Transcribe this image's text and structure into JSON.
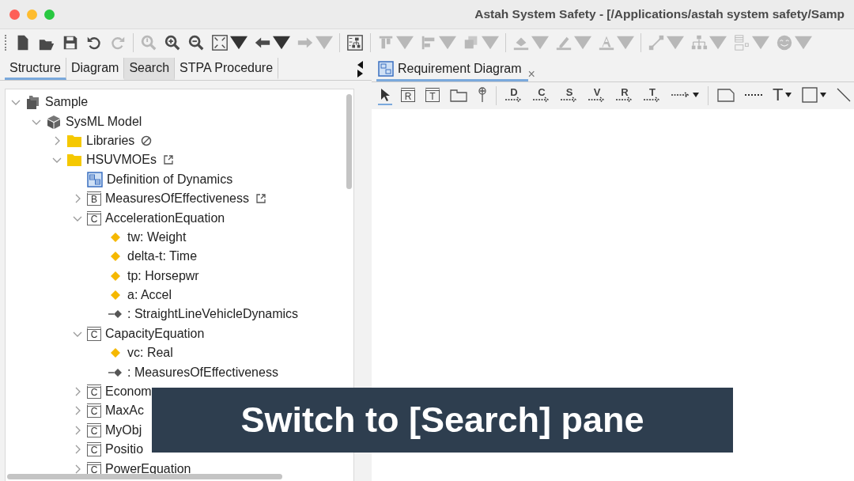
{
  "window": {
    "title": "Astah System Safety - [/Applications/astah system safety/Samp"
  },
  "main_toolbar": [
    {
      "kind": "new",
      "disabled": false,
      "dropdown": false
    },
    {
      "kind": "open",
      "disabled": false,
      "dropdown": false
    },
    {
      "kind": "save",
      "disabled": false,
      "dropdown": false
    },
    {
      "kind": "undo",
      "disabled": false,
      "dropdown": false
    },
    {
      "kind": "redo",
      "disabled": true,
      "dropdown": false
    },
    {
      "kind": "separator"
    },
    {
      "kind": "find",
      "disabled": true,
      "dropdown": false
    },
    {
      "kind": "zoom-in",
      "disabled": false,
      "dropdown": false
    },
    {
      "kind": "zoom-out",
      "disabled": false,
      "dropdown": false
    },
    {
      "kind": "fit",
      "disabled": false,
      "dropdown": true
    },
    {
      "kind": "back",
      "disabled": false,
      "dropdown": true
    },
    {
      "kind": "forward",
      "disabled": true,
      "dropdown": true
    },
    {
      "kind": "separator"
    },
    {
      "kind": "layout",
      "disabled": false,
      "dropdown": false
    },
    {
      "kind": "separator"
    },
    {
      "kind": "align-top",
      "disabled": true,
      "dropdown": true
    },
    {
      "kind": "align-left",
      "disabled": true,
      "dropdown": true
    },
    {
      "kind": "stack",
      "disabled": true,
      "dropdown": true
    },
    {
      "kind": "separator"
    },
    {
      "kind": "fill",
      "disabled": true,
      "dropdown": true
    },
    {
      "kind": "pen",
      "disabled": true,
      "dropdown": true
    },
    {
      "kind": "font",
      "disabled": true,
      "dropdown": true
    },
    {
      "kind": "separator"
    },
    {
      "kind": "line",
      "disabled": true,
      "dropdown": true
    },
    {
      "kind": "tree",
      "disabled": true,
      "dropdown": true
    },
    {
      "kind": "list",
      "disabled": true,
      "dropdown": true
    },
    {
      "kind": "smiley",
      "disabled": true,
      "dropdown": true
    }
  ],
  "side_tabs": [
    {
      "label": "Structure",
      "selected": true,
      "hovered": false
    },
    {
      "label": "Diagram",
      "selected": false,
      "hovered": false
    },
    {
      "label": "Search",
      "selected": false,
      "hovered": true
    },
    {
      "label": "STPA Procedure",
      "selected": false,
      "hovered": false
    }
  ],
  "tree": [
    {
      "label": "Sample",
      "kind": "project",
      "expanded": true,
      "children": [
        {
          "label": "SysML Model",
          "kind": "model",
          "expanded": true,
          "children": [
            {
              "label": "Libraries",
              "kind": "folder",
              "expanded": false,
              "badge": {
                "kind": "blocked"
              }
            },
            {
              "label": "HSUVMOEs",
              "kind": "folder",
              "expanded": true,
              "badge": {
                "kind": "link"
              },
              "children": [
                {
                  "label": "Definition of Dynamics",
                  "kind": "diagram"
                },
                {
                  "label": "MeasuresOfEffectiveness",
                  "kind": "block",
                  "icon_text": "B",
                  "expanded": false,
                  "badge": {
                    "kind": "link"
                  }
                },
                {
                  "label": "AccelerationEquation",
                  "kind": "constraint",
                  "icon_text": "C",
                  "expanded": true,
                  "children": [
                    {
                      "label": "tw: Weight",
                      "kind": "property"
                    },
                    {
                      "label": "delta-t: Time",
                      "kind": "property"
                    },
                    {
                      "label": "tp: Horsepwr",
                      "kind": "property"
                    },
                    {
                      "label": "a: Accel",
                      "kind": "property"
                    },
                    {
                      "label": ": StraightLineVehicleDynamics",
                      "kind": "part"
                    }
                  ]
                },
                {
                  "label": "CapacityEquation",
                  "kind": "constraint",
                  "icon_text": "C",
                  "expanded": true,
                  "children": [
                    {
                      "label": "vc: Real",
                      "kind": "property"
                    },
                    {
                      "label": ": MeasuresOfEffectiveness",
                      "kind": "part"
                    }
                  ]
                },
                {
                  "label": "Econom",
                  "kind": "constraint",
                  "icon_text": "C",
                  "expanded": false
                },
                {
                  "label": "MaxAc",
                  "kind": "constraint",
                  "icon_text": "C",
                  "expanded": false
                },
                {
                  "label": "MyObj",
                  "kind": "constraint",
                  "icon_text": "C",
                  "expanded": false
                },
                {
                  "label": "Positio",
                  "kind": "constraint",
                  "icon_text": "C",
                  "expanded": false
                },
                {
                  "label": "PowerEquation",
                  "kind": "constraint",
                  "icon_text": "C",
                  "expanded": false
                }
              ]
            }
          ]
        }
      ]
    }
  ],
  "editor_tabs": [
    {
      "label": "Requirement Diagram",
      "selected": true,
      "close": "×"
    }
  ],
  "diagram_toolbar": [
    {
      "kind": "pointer",
      "selected": true
    },
    {
      "kind": "boxed-letter",
      "text": "R",
      "selected": false
    },
    {
      "kind": "boxed-letter",
      "text": "T",
      "selected": false
    },
    {
      "kind": "package",
      "selected": false
    },
    {
      "kind": "pin",
      "selected": false
    },
    {
      "kind": "separator"
    },
    {
      "kind": "letter-arrow",
      "text": "D",
      "selected": false
    },
    {
      "kind": "letter-arrow",
      "text": "C",
      "selected": false
    },
    {
      "kind": "letter-arrow",
      "text": "S",
      "selected": false
    },
    {
      "kind": "letter-arrow",
      "text": "V",
      "selected": false
    },
    {
      "kind": "letter-arrow",
      "text": "R",
      "selected": false
    },
    {
      "kind": "letter-arrow",
      "text": "T",
      "selected": false
    },
    {
      "kind": "dotted-arrow",
      "selected": false,
      "dropdown": true
    },
    {
      "kind": "separator"
    },
    {
      "kind": "note",
      "selected": false
    },
    {
      "kind": "dotted-line",
      "selected": false
    },
    {
      "kind": "text-tool",
      "text": "T",
      "selected": false,
      "dropdown": true
    },
    {
      "kind": "rectangle",
      "selected": false,
      "dropdown": true
    },
    {
      "kind": "line",
      "selected": false
    }
  ],
  "caption": "Switch to [Search] pane"
}
